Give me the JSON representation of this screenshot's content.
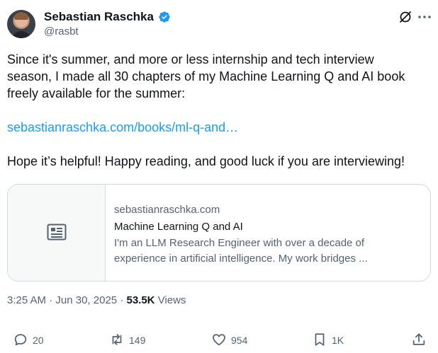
{
  "author": {
    "name": "Sebastian Raschka",
    "handle": "@rasbt",
    "verified_color": "#1d9bf0"
  },
  "tweet": {
    "lines": [
      "Since it's summer, and more or less internship and tech interview",
      "season, I  made all 30 chapters of my Machine Learning Q and AI book",
      "freely available for the summer:"
    ],
    "link_text": "sebastianraschka.com/books/ml-q-and…",
    "closing": "Hope it’s helpful! Happy reading, and good luck if you are interviewing!"
  },
  "card": {
    "domain": "sebastianraschka.com",
    "title": "Machine Learning Q and AI",
    "description_lines": [
      "I'm an LLM Research Engineer with over a decade of",
      "experience in artificial intelligence. My work bridges ..."
    ]
  },
  "meta": {
    "time": "3:25 AM",
    "date": "Jun 30, 2025",
    "views_count": "53.5K",
    "views_label": "Views",
    "separator": "·"
  },
  "actions": {
    "replies": "20",
    "reposts": "149",
    "likes": "954",
    "bookmarks": "1K"
  },
  "icons": {
    "grok": "grok-icon",
    "more": "more-icon",
    "reply": "reply-icon",
    "repost": "repost-icon",
    "like": "heart-icon",
    "bookmark": "bookmark-icon",
    "share": "share-icon",
    "article": "article-icon"
  }
}
